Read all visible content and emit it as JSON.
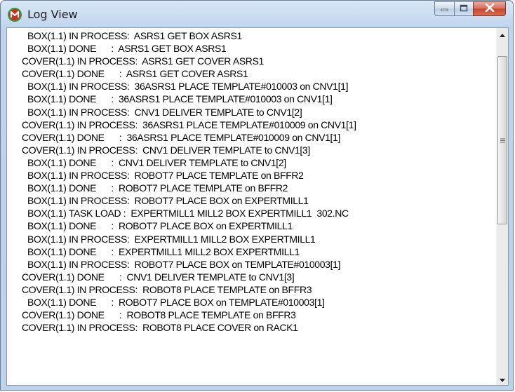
{
  "window": {
    "title": "Log View"
  },
  "log_lines": [
    {
      "indent": 1,
      "text": "BOX(1.1) IN PROCESS:  ASRS1 GET BOX ASRS1"
    },
    {
      "indent": 1,
      "text": "BOX(1.1) DONE      :  ASRS1 GET BOX ASRS1"
    },
    {
      "indent": 0,
      "text": "COVER(1.1) IN PROCESS:  ASRS1 GET COVER ASRS1"
    },
    {
      "indent": 0,
      "text": "COVER(1.1) DONE      :  ASRS1 GET COVER ASRS1"
    },
    {
      "indent": 1,
      "text": "BOX(1.1) IN PROCESS:  36ASRS1 PLACE TEMPLATE#010003 on CNV1[1]"
    },
    {
      "indent": 1,
      "text": "BOX(1.1) DONE      :  36ASRS1 PLACE TEMPLATE#010003 on CNV1[1]"
    },
    {
      "indent": 1,
      "text": "BOX(1.1) IN PROCESS:  CNV1 DELIVER TEMPLATE to CNV1[2]"
    },
    {
      "indent": 0,
      "text": "COVER(1.1) IN PROCESS:  36ASRS1 PLACE TEMPLATE#010009 on CNV1[1]"
    },
    {
      "indent": 0,
      "text": "COVER(1.1) DONE      :  36ASRS1 PLACE TEMPLATE#010009 on CNV1[1]"
    },
    {
      "indent": 0,
      "text": "COVER(1.1) IN PROCESS:  CNV1 DELIVER TEMPLATE to CNV1[3]"
    },
    {
      "indent": 1,
      "text": "BOX(1.1) DONE      :  CNV1 DELIVER TEMPLATE to CNV1[2]"
    },
    {
      "indent": 1,
      "text": "BOX(1.1) IN PROCESS:  ROBOT7 PLACE TEMPLATE on BFFR2"
    },
    {
      "indent": 1,
      "text": "BOX(1.1) DONE      :  ROBOT7 PLACE TEMPLATE on BFFR2"
    },
    {
      "indent": 1,
      "text": "BOX(1.1) IN PROCESS:  ROBOT7 PLACE BOX on EXPERTMILL1"
    },
    {
      "indent": 1,
      "text": "BOX(1.1) TASK LOAD :  EXPERTMILL1 MILL2 BOX EXPERTMILL1  302.NC"
    },
    {
      "indent": 1,
      "text": "BOX(1.1) DONE      :  ROBOT7 PLACE BOX on EXPERTMILL1"
    },
    {
      "indent": 1,
      "text": "BOX(1.1) IN PROCESS:  EXPERTMILL1 MILL2 BOX EXPERTMILL1"
    },
    {
      "indent": 1,
      "text": "BOX(1.1) DONE      :  EXPERTMILL1 MILL2 BOX EXPERTMILL1"
    },
    {
      "indent": 1,
      "text": "BOX(1.1) IN PROCESS:  ROBOT7 PLACE BOX on TEMPLATE#010003[1]"
    },
    {
      "indent": 0,
      "text": "COVER(1.1) DONE      :  CNV1 DELIVER TEMPLATE to CNV1[3]"
    },
    {
      "indent": 0,
      "text": "COVER(1.1) IN PROCESS:  ROBOT8 PLACE TEMPLATE on BFFR3"
    },
    {
      "indent": 1,
      "text": "BOX(1.1) DONE      :  ROBOT7 PLACE BOX on TEMPLATE#010003[1]"
    },
    {
      "indent": 0,
      "text": "COVER(1.1) DONE      :  ROBOT8 PLACE TEMPLATE on BFFR3"
    },
    {
      "indent": 0,
      "text": "COVER(1.1) IN PROCESS:  ROBOT8 PLACE COVER on RACK1"
    }
  ],
  "colors": {
    "close_button": "#c9472c",
    "app_icon_red": "#d42a1f",
    "app_icon_green": "#2aa33c"
  }
}
